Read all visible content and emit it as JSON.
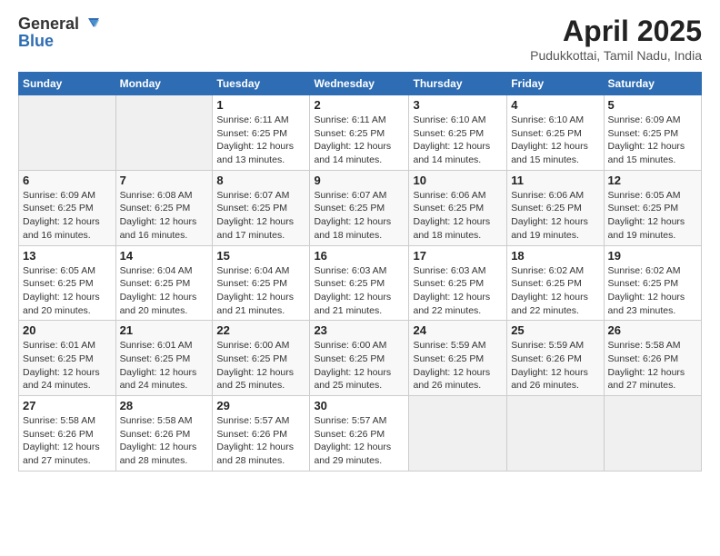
{
  "header": {
    "logo_general": "General",
    "logo_blue": "Blue",
    "title": "April 2025",
    "subtitle": "Pudukkottai, Tamil Nadu, India"
  },
  "calendar": {
    "days_of_week": [
      "Sunday",
      "Monday",
      "Tuesday",
      "Wednesday",
      "Thursday",
      "Friday",
      "Saturday"
    ],
    "weeks": [
      [
        {
          "day": "",
          "info": ""
        },
        {
          "day": "",
          "info": ""
        },
        {
          "day": "1",
          "info": "Sunrise: 6:11 AM\nSunset: 6:25 PM\nDaylight: 12 hours and 13 minutes."
        },
        {
          "day": "2",
          "info": "Sunrise: 6:11 AM\nSunset: 6:25 PM\nDaylight: 12 hours and 14 minutes."
        },
        {
          "day": "3",
          "info": "Sunrise: 6:10 AM\nSunset: 6:25 PM\nDaylight: 12 hours and 14 minutes."
        },
        {
          "day": "4",
          "info": "Sunrise: 6:10 AM\nSunset: 6:25 PM\nDaylight: 12 hours and 15 minutes."
        },
        {
          "day": "5",
          "info": "Sunrise: 6:09 AM\nSunset: 6:25 PM\nDaylight: 12 hours and 15 minutes."
        }
      ],
      [
        {
          "day": "6",
          "info": "Sunrise: 6:09 AM\nSunset: 6:25 PM\nDaylight: 12 hours and 16 minutes."
        },
        {
          "day": "7",
          "info": "Sunrise: 6:08 AM\nSunset: 6:25 PM\nDaylight: 12 hours and 16 minutes."
        },
        {
          "day": "8",
          "info": "Sunrise: 6:07 AM\nSunset: 6:25 PM\nDaylight: 12 hours and 17 minutes."
        },
        {
          "day": "9",
          "info": "Sunrise: 6:07 AM\nSunset: 6:25 PM\nDaylight: 12 hours and 18 minutes."
        },
        {
          "day": "10",
          "info": "Sunrise: 6:06 AM\nSunset: 6:25 PM\nDaylight: 12 hours and 18 minutes."
        },
        {
          "day": "11",
          "info": "Sunrise: 6:06 AM\nSunset: 6:25 PM\nDaylight: 12 hours and 19 minutes."
        },
        {
          "day": "12",
          "info": "Sunrise: 6:05 AM\nSunset: 6:25 PM\nDaylight: 12 hours and 19 minutes."
        }
      ],
      [
        {
          "day": "13",
          "info": "Sunrise: 6:05 AM\nSunset: 6:25 PM\nDaylight: 12 hours and 20 minutes."
        },
        {
          "day": "14",
          "info": "Sunrise: 6:04 AM\nSunset: 6:25 PM\nDaylight: 12 hours and 20 minutes."
        },
        {
          "day": "15",
          "info": "Sunrise: 6:04 AM\nSunset: 6:25 PM\nDaylight: 12 hours and 21 minutes."
        },
        {
          "day": "16",
          "info": "Sunrise: 6:03 AM\nSunset: 6:25 PM\nDaylight: 12 hours and 21 minutes."
        },
        {
          "day": "17",
          "info": "Sunrise: 6:03 AM\nSunset: 6:25 PM\nDaylight: 12 hours and 22 minutes."
        },
        {
          "day": "18",
          "info": "Sunrise: 6:02 AM\nSunset: 6:25 PM\nDaylight: 12 hours and 22 minutes."
        },
        {
          "day": "19",
          "info": "Sunrise: 6:02 AM\nSunset: 6:25 PM\nDaylight: 12 hours and 23 minutes."
        }
      ],
      [
        {
          "day": "20",
          "info": "Sunrise: 6:01 AM\nSunset: 6:25 PM\nDaylight: 12 hours and 24 minutes."
        },
        {
          "day": "21",
          "info": "Sunrise: 6:01 AM\nSunset: 6:25 PM\nDaylight: 12 hours and 24 minutes."
        },
        {
          "day": "22",
          "info": "Sunrise: 6:00 AM\nSunset: 6:25 PM\nDaylight: 12 hours and 25 minutes."
        },
        {
          "day": "23",
          "info": "Sunrise: 6:00 AM\nSunset: 6:25 PM\nDaylight: 12 hours and 25 minutes."
        },
        {
          "day": "24",
          "info": "Sunrise: 5:59 AM\nSunset: 6:25 PM\nDaylight: 12 hours and 26 minutes."
        },
        {
          "day": "25",
          "info": "Sunrise: 5:59 AM\nSunset: 6:26 PM\nDaylight: 12 hours and 26 minutes."
        },
        {
          "day": "26",
          "info": "Sunrise: 5:58 AM\nSunset: 6:26 PM\nDaylight: 12 hours and 27 minutes."
        }
      ],
      [
        {
          "day": "27",
          "info": "Sunrise: 5:58 AM\nSunset: 6:26 PM\nDaylight: 12 hours and 27 minutes."
        },
        {
          "day": "28",
          "info": "Sunrise: 5:58 AM\nSunset: 6:26 PM\nDaylight: 12 hours and 28 minutes."
        },
        {
          "day": "29",
          "info": "Sunrise: 5:57 AM\nSunset: 6:26 PM\nDaylight: 12 hours and 28 minutes."
        },
        {
          "day": "30",
          "info": "Sunrise: 5:57 AM\nSunset: 6:26 PM\nDaylight: 12 hours and 29 minutes."
        },
        {
          "day": "",
          "info": ""
        },
        {
          "day": "",
          "info": ""
        },
        {
          "day": "",
          "info": ""
        }
      ]
    ]
  }
}
